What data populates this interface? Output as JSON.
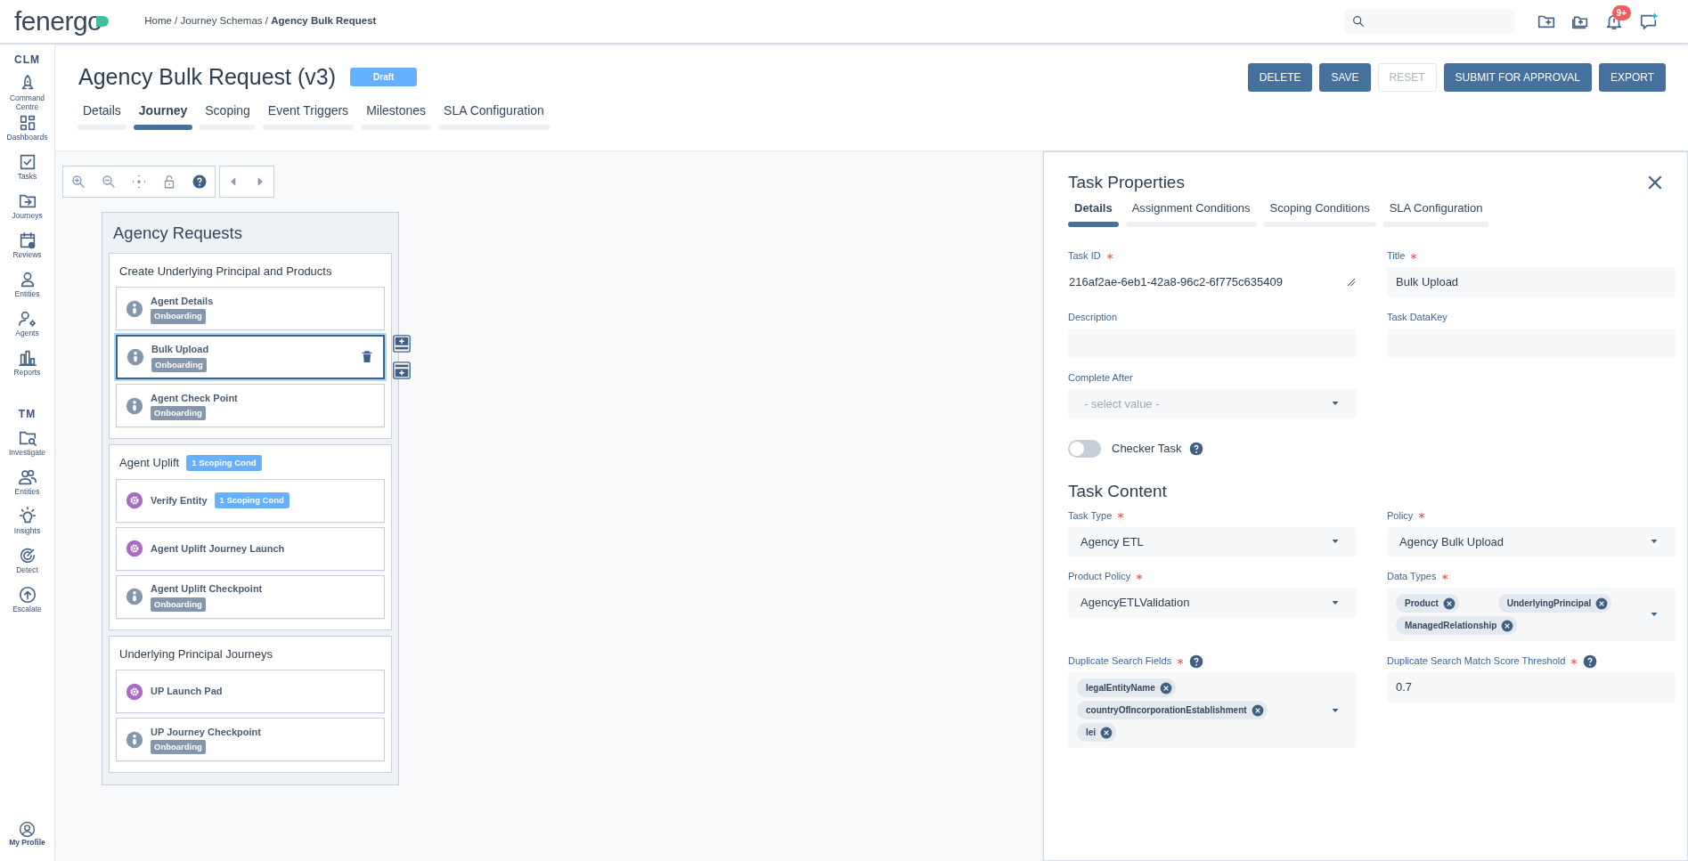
{
  "topbar": {
    "logo": "fenergo",
    "breadcrumb": "Home / Journey Schemas / **Agency Bulk Request**",
    "notification_count": "9+"
  },
  "sidebar": {
    "sections": [
      {
        "label": "CLM",
        "items": [
          {
            "label": "Command Centre"
          },
          {
            "label": "Dashboards"
          },
          {
            "label": "Tasks"
          },
          {
            "label": "Journeys"
          },
          {
            "label": "Reviews"
          },
          {
            "label": "Entities"
          },
          {
            "label": "Agents"
          },
          {
            "label": "Reports"
          }
        ]
      },
      {
        "label": "TM",
        "items": [
          {
            "label": "Investigate"
          },
          {
            "label": "Entities"
          },
          {
            "label": "Insights"
          },
          {
            "label": "Detect"
          },
          {
            "label": "Escalate"
          }
        ]
      }
    ],
    "profile": "My Profile"
  },
  "header": {
    "title": "Agency Bulk Request (v3)",
    "status": "Draft",
    "buttons": [
      {
        "label": "DELETE",
        "disabled": false
      },
      {
        "label": "SAVE",
        "disabled": false
      },
      {
        "label": "RESET",
        "disabled": true
      },
      {
        "label": "SUBMIT FOR APPROVAL",
        "disabled": false
      },
      {
        "label": "EXPORT",
        "disabled": false
      }
    ],
    "tabs": [
      {
        "label": "Details",
        "selected": false
      },
      {
        "label": "Journey",
        "selected": true
      },
      {
        "label": "Scoping",
        "selected": false
      },
      {
        "label": "Event Triggers",
        "selected": false
      },
      {
        "label": "Milestones",
        "selected": false
      },
      {
        "label": "SLA Configuration",
        "selected": false
      }
    ]
  },
  "canvas": {
    "lane": {
      "title": "Agency Requests",
      "stages": [
        {
          "title": "Create Underlying Principal and Products",
          "tasks": [
            {
              "name": "Agent Details",
              "kind": "manual",
              "tag": "Onboarding",
              "selected": false
            },
            {
              "name": "Bulk Upload",
              "kind": "manual",
              "tag": "Onboarding",
              "selected": true
            },
            {
              "name": "Agent Check Point",
              "kind": "manual",
              "tag": "Onboarding",
              "selected": false
            }
          ]
        },
        {
          "title": "Agent Uplift",
          "badge": "1 Scoping Cond",
          "tasks": [
            {
              "name": "Verify Entity",
              "kind": "automated",
              "badge": "1 Scoping Cond",
              "selected": false
            },
            {
              "name": "Agent Uplift Journey Launch",
              "kind": "automated",
              "selected": false
            },
            {
              "name": "Agent Uplift Checkpoint",
              "kind": "manual",
              "tag": "Onboarding",
              "selected": false
            }
          ]
        },
        {
          "title": "Underlying Principal Journeys",
          "tasks": [
            {
              "name": "UP Launch Pad",
              "kind": "automated",
              "selected": false
            },
            {
              "name": "UP Journey Checkpoint",
              "kind": "manual",
              "tag": "Onboarding",
              "selected": false
            }
          ]
        }
      ]
    }
  },
  "panel": {
    "title": "Task Properties",
    "tabs": [
      {
        "label": "Details",
        "selected": true
      },
      {
        "label": "Assignment Conditions",
        "selected": false
      },
      {
        "label": "Scoping Conditions",
        "selected": false
      },
      {
        "label": "SLA Configuration",
        "selected": false
      }
    ],
    "fields": [
      {
        "label": "Task ID",
        "required": true,
        "kind": "readonly",
        "value": "216af2ae-6eb1-42a8-96c2-6f775c635409"
      },
      {
        "label": "Title",
        "required": true,
        "kind": "text",
        "value": "Bulk Upload"
      },
      {
        "label": "Description",
        "required": false,
        "kind": "text"
      },
      {
        "label": "Task DataKey",
        "required": false,
        "kind": "text"
      },
      {
        "label": "Complete After",
        "required": false,
        "kind": "select",
        "placeholder": "- select value -"
      }
    ],
    "checker_task": {
      "label": "Checker Task",
      "on": false
    },
    "content_title": "Task Content",
    "content_fields": [
      {
        "label": "Task Type",
        "required": true,
        "kind": "select",
        "value": "Agency ETL"
      },
      {
        "label": "Policy",
        "required": true,
        "kind": "select",
        "value": "Agency Bulk Upload"
      },
      {
        "label": "Product Policy",
        "required": true,
        "kind": "select",
        "value": "AgencyETLValidation"
      },
      {
        "label": "Data Types",
        "required": true,
        "kind": "multiselect",
        "chips": [
          "Product",
          "UnderlyingPrincipal",
          "ManagedRelationship"
        ]
      },
      {
        "label": "Duplicate Search Fields",
        "required": true,
        "help": true,
        "kind": "multiselect",
        "chips": [
          "legalEntityName",
          "countryOfIncorporationEstablishment",
          "lei"
        ]
      },
      {
        "label": "Duplicate Search Match Score Threshold",
        "required": true,
        "help": true,
        "kind": "text",
        "value": "0.7"
      }
    ]
  }
}
